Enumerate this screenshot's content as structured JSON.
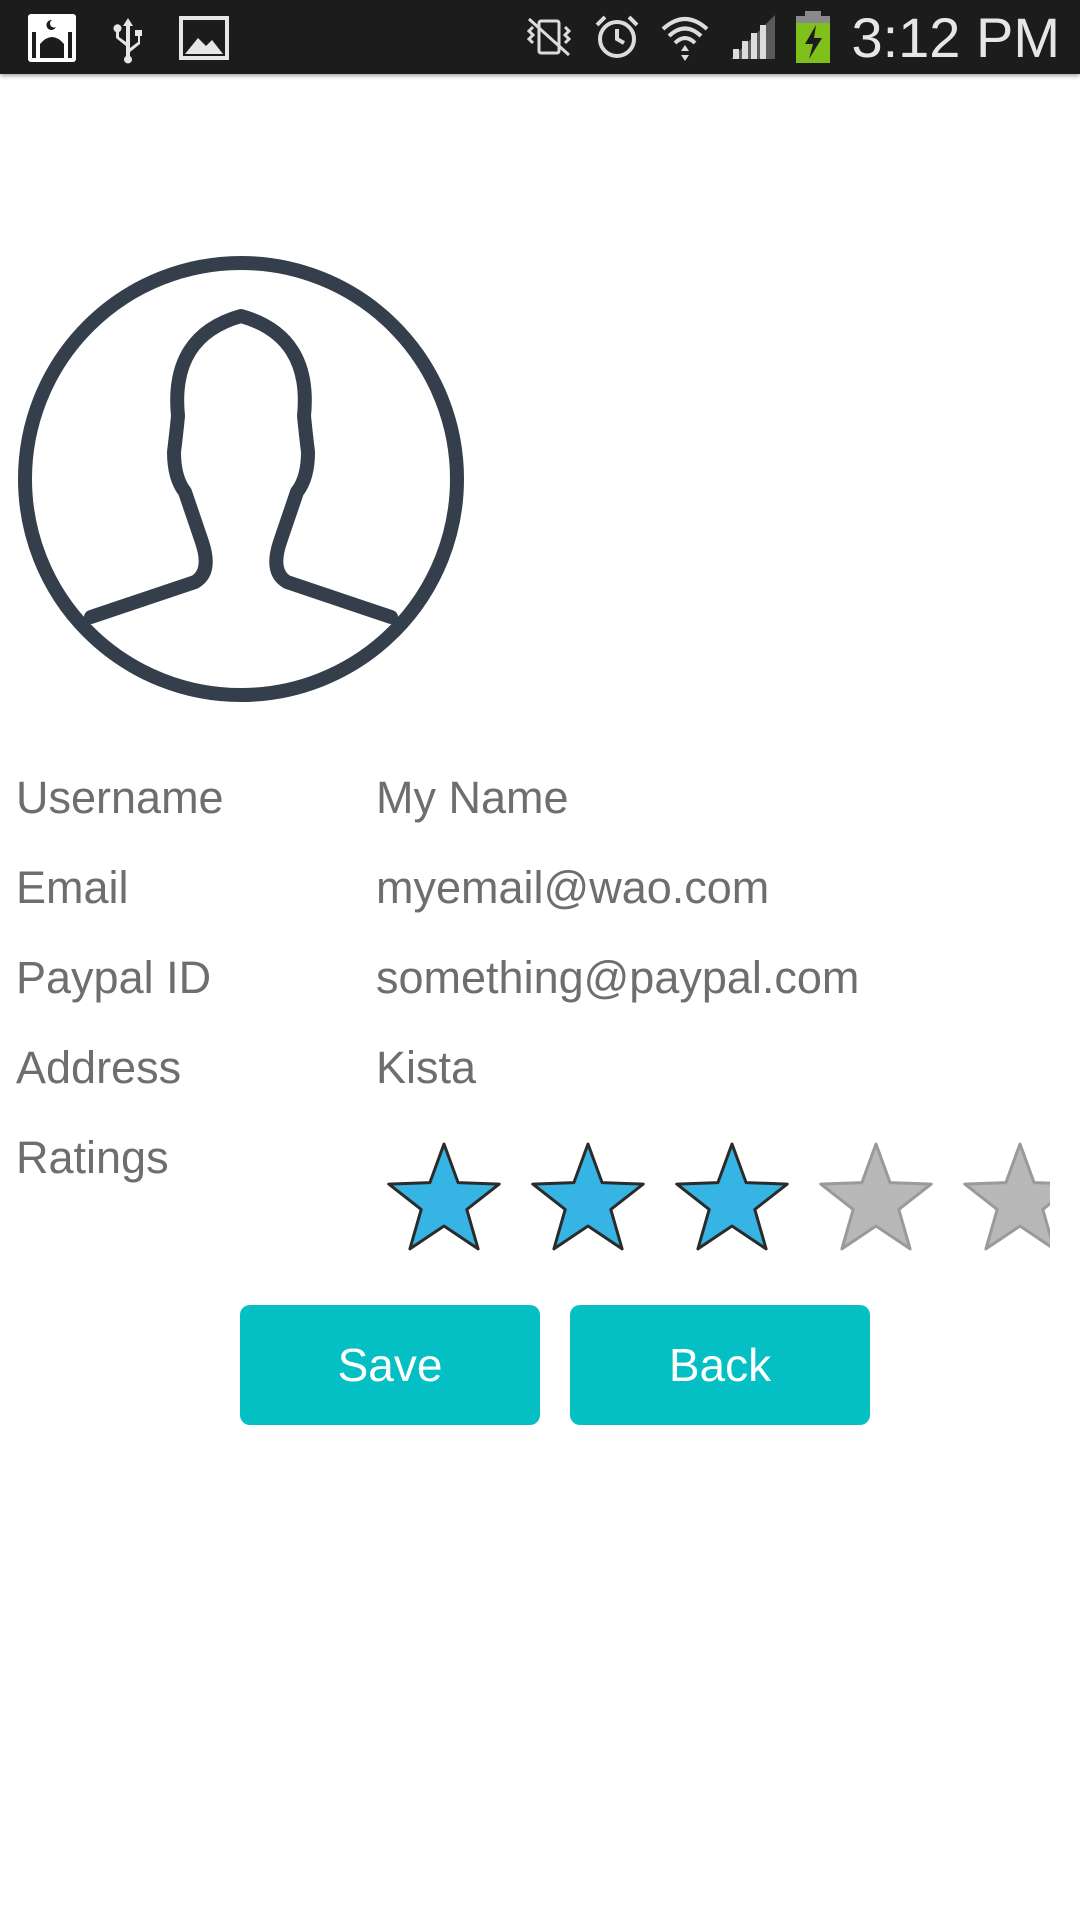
{
  "status_bar": {
    "time": "3:12 PM",
    "icons_left": [
      "mosque-app-icon",
      "usb-icon",
      "image-icon"
    ],
    "icons_right": [
      "vibrate-mute-icon",
      "alarm-icon",
      "wifi-icon",
      "signal-icon",
      "battery-charging-icon"
    ]
  },
  "profile": {
    "avatar_icon": "user-silhouette-icon",
    "fields": [
      {
        "label": "Username",
        "value": "My Name"
      },
      {
        "label": "Email",
        "value": "myemail@wao.com"
      },
      {
        "label": "Paypal ID",
        "value": "something@paypal.com"
      },
      {
        "label": "Address",
        "value": "Kista"
      }
    ],
    "ratings_label": "Ratings",
    "rating": {
      "value": 3,
      "max": 5
    }
  },
  "buttons": {
    "save_label": "Save",
    "back_label": "Back"
  },
  "colors": {
    "accent": "#04bfc3",
    "star_filled": "#36b5e5",
    "star_empty": "#b8b8b8",
    "text": "#6e6e6e",
    "avatar_stroke": "#353f4c"
  }
}
